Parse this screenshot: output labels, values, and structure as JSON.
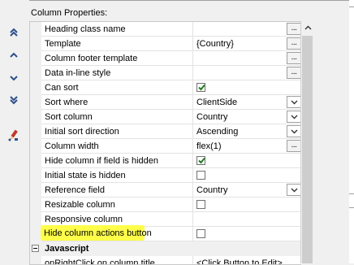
{
  "section_title": "Column Properties:",
  "sidebar": {
    "buttons": [
      {
        "name": "move-to-top",
        "icon": "double-chevron-up-icon"
      },
      {
        "name": "move-up",
        "icon": "chevron-up-icon"
      },
      {
        "name": "move-down",
        "icon": "chevron-down-icon"
      },
      {
        "name": "move-to-bottom",
        "icon": "double-chevron-down-icon"
      },
      {
        "name": "edit-properties",
        "icon": "pencil-brush-icon"
      }
    ]
  },
  "properties": [
    {
      "name": "Heading class name",
      "value": "",
      "editor": "ellipsis"
    },
    {
      "name": "Template",
      "value": "{Country}",
      "editor": "ellipsis"
    },
    {
      "name": "Column footer template",
      "value": "",
      "editor": "ellipsis"
    },
    {
      "name": "Data in-line style",
      "value": "",
      "editor": "ellipsis"
    },
    {
      "name": "Can sort",
      "value": "",
      "editor": "checkbox",
      "checked": true
    },
    {
      "name": "Sort where",
      "value": "ClientSide",
      "editor": "dropdown"
    },
    {
      "name": "Sort column",
      "value": "Country",
      "editor": "dropdown"
    },
    {
      "name": "Initial sort direction",
      "value": "Ascending",
      "editor": "dropdown"
    },
    {
      "name": "Column width",
      "value": "flex(1)",
      "editor": "ellipsis"
    },
    {
      "name": "Hide column if field is hidden",
      "value": "",
      "editor": "checkbox",
      "checked": true
    },
    {
      "name": "Initial state is hidden",
      "value": "",
      "editor": "checkbox",
      "checked": false
    },
    {
      "name": "Reference field",
      "value": "Country",
      "editor": "dropdown"
    },
    {
      "name": "Resizable column",
      "value": "",
      "editor": "checkbox",
      "checked": false
    },
    {
      "name": "Responsive column",
      "value": "",
      "editor": "none"
    },
    {
      "name": "Hide column actions button",
      "value": "",
      "editor": "checkbox",
      "checked": false
    }
  ],
  "category": {
    "label": "Javascript",
    "collapse_symbol": "−"
  },
  "last_row": {
    "name": "onRightClick on column title",
    "value": "<Click Button to Edit>"
  },
  "ellipsis_label": "...",
  "colors": {
    "highlight": "#ffff4a",
    "checkmark": "#1e7d1e",
    "icon_blue": "#2d4f8b"
  }
}
